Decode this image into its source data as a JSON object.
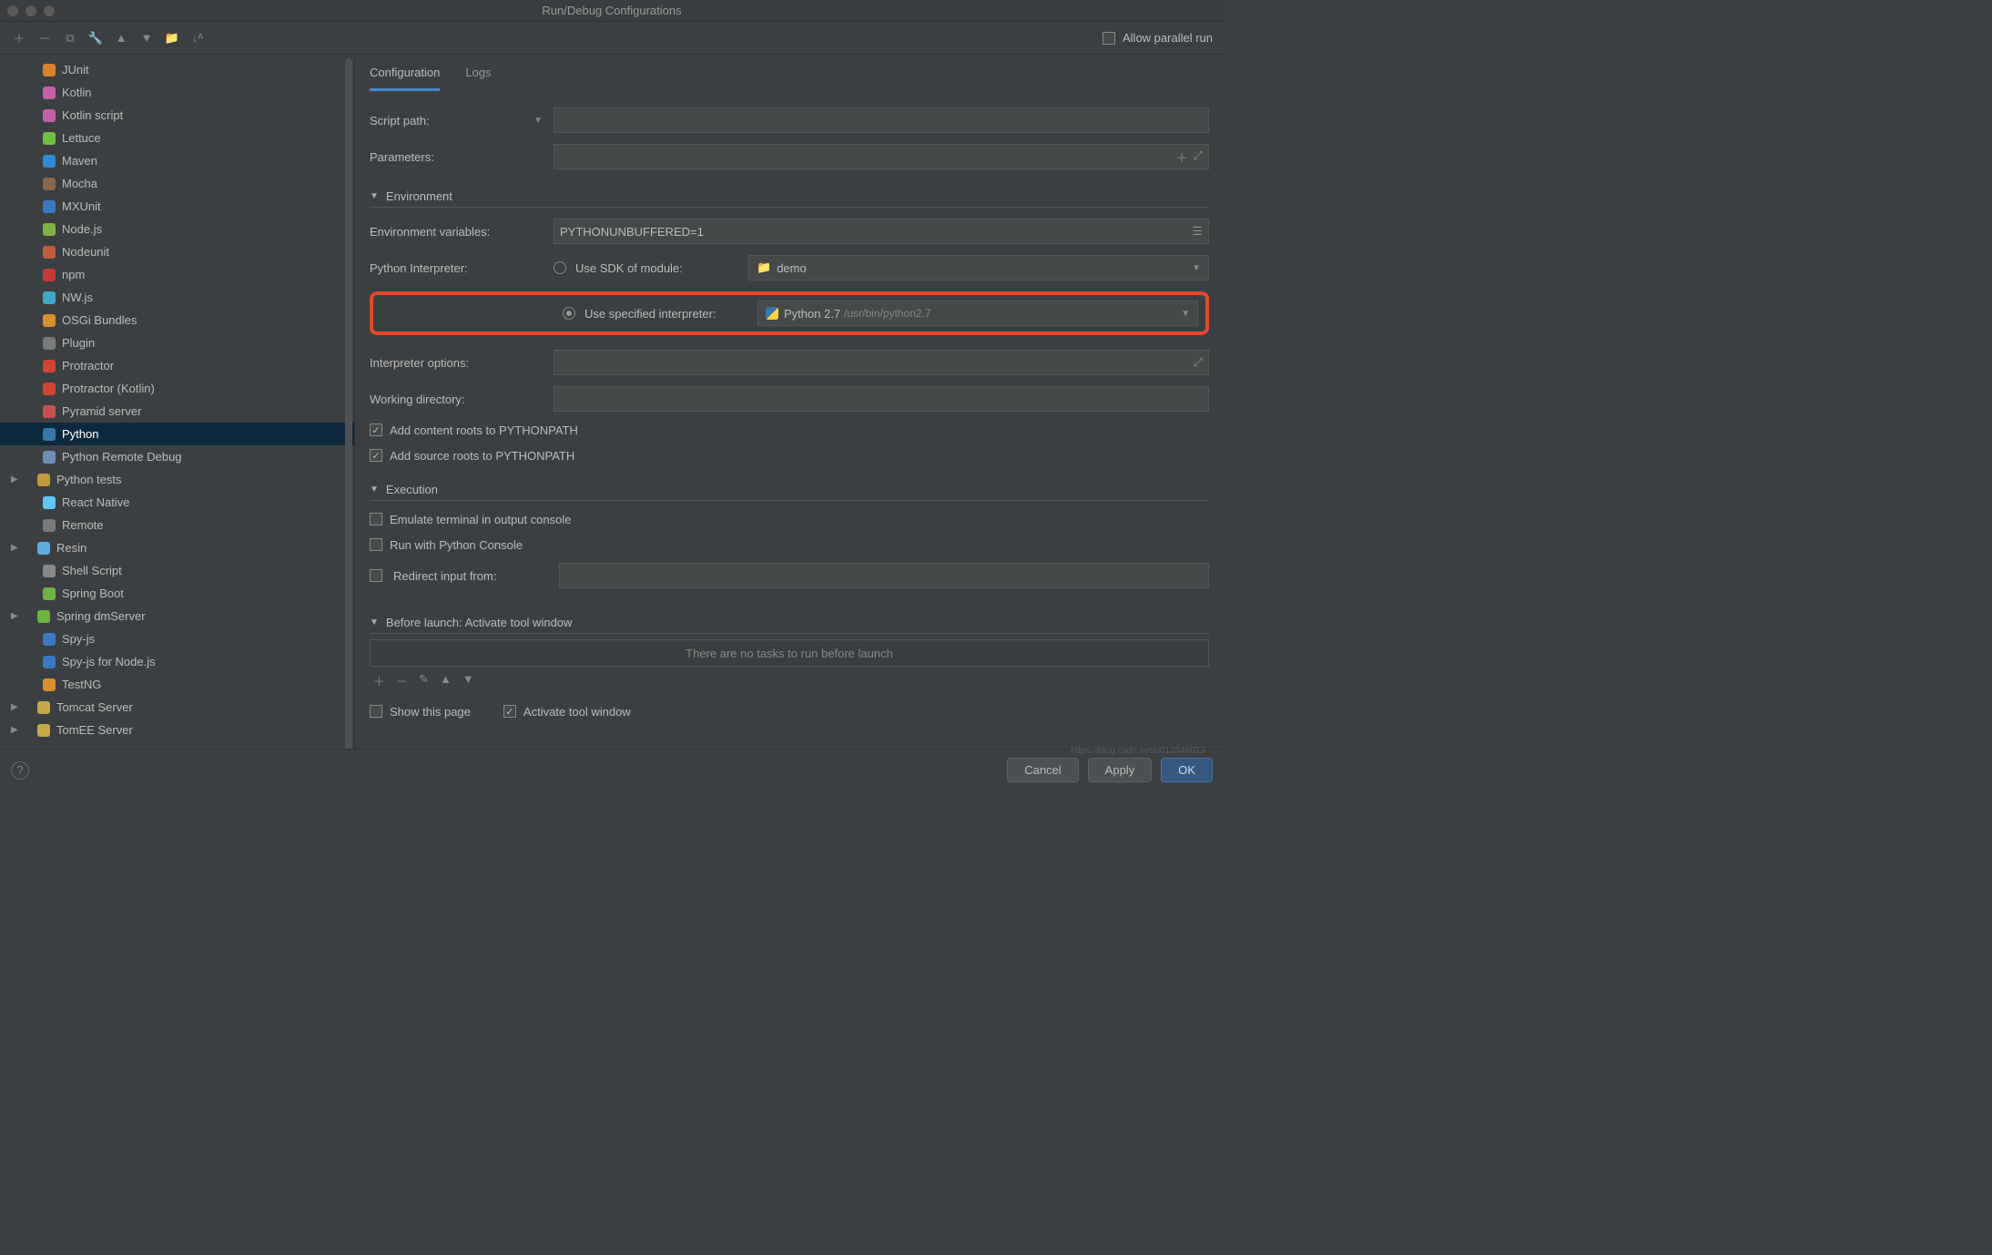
{
  "window": {
    "title": "Run/Debug Configurations"
  },
  "toolbar": {
    "allow_parallel": "Allow parallel run"
  },
  "sidebar": {
    "items": [
      {
        "label": "JUnit",
        "icon_color": "#d9822b",
        "arrow": false
      },
      {
        "label": "Kotlin",
        "icon_color": "#c75eaa",
        "arrow": false
      },
      {
        "label": "Kotlin script",
        "icon_color": "#c75eaa",
        "arrow": false
      },
      {
        "label": "Lettuce",
        "icon_color": "#6fbf3f",
        "arrow": false
      },
      {
        "label": "Maven",
        "icon_color": "#2e8bd8",
        "arrow": false
      },
      {
        "label": "Mocha",
        "icon_color": "#8d6748",
        "arrow": false
      },
      {
        "label": "MXUnit",
        "icon_color": "#3a78c4",
        "arrow": false
      },
      {
        "label": "Node.js",
        "icon_color": "#7cb342",
        "arrow": false
      },
      {
        "label": "Nodeunit",
        "icon_color": "#c15b3a",
        "arrow": false
      },
      {
        "label": "npm",
        "icon_color": "#cb3837",
        "arrow": false
      },
      {
        "label": "NW.js",
        "icon_color": "#3fa9c9",
        "arrow": false
      },
      {
        "label": "OSGi Bundles",
        "icon_color": "#d98f2b",
        "arrow": false
      },
      {
        "label": "Plugin",
        "icon_color": "#7a7a7a",
        "arrow": false
      },
      {
        "label": "Protractor",
        "icon_color": "#d24432",
        "arrow": false
      },
      {
        "label": "Protractor (Kotlin)",
        "icon_color": "#d24432",
        "arrow": false
      },
      {
        "label": "Pyramid server",
        "icon_color": "#c75050",
        "arrow": false
      },
      {
        "label": "Python",
        "icon_color": "#3776ab",
        "arrow": false,
        "selected": true
      },
      {
        "label": "Python Remote Debug",
        "icon_color": "#6a8fb5",
        "arrow": false
      },
      {
        "label": "Python tests",
        "icon_color": "#c19a3a",
        "arrow": true
      },
      {
        "label": "React Native",
        "icon_color": "#5ec8f8",
        "arrow": false
      },
      {
        "label": "Remote",
        "icon_color": "#7a7a7a",
        "arrow": false
      },
      {
        "label": "Resin",
        "icon_color": "#5dade2",
        "arrow": true
      },
      {
        "label": "Shell Script",
        "icon_color": "#888888",
        "arrow": false
      },
      {
        "label": "Spring Boot",
        "icon_color": "#6db33f",
        "arrow": false
      },
      {
        "label": "Spring dmServer",
        "icon_color": "#6db33f",
        "arrow": true
      },
      {
        "label": "Spy-js",
        "icon_color": "#3a78c4",
        "arrow": false
      },
      {
        "label": "Spy-js for Node.js",
        "icon_color": "#3a78c4",
        "arrow": false
      },
      {
        "label": "TestNG",
        "icon_color": "#d98f2b",
        "arrow": false
      },
      {
        "label": "Tomcat Server",
        "icon_color": "#c6a94b",
        "arrow": true
      },
      {
        "label": "TomEE Server",
        "icon_color": "#c6a94b",
        "arrow": true
      }
    ]
  },
  "tabs": {
    "configuration": "Configuration",
    "logs": "Logs"
  },
  "labels": {
    "script_path": "Script path:",
    "parameters": "Parameters:",
    "environment": "Environment",
    "env_vars": "Environment variables:",
    "python_interp": "Python Interpreter:",
    "use_sdk": "Use SDK of module:",
    "use_spec": "Use specified interpreter:",
    "interp_opts": "Interpreter options:",
    "working_dir": "Working directory:",
    "add_content": "Add content roots to PYTHONPATH",
    "add_source": "Add source roots to PYTHONPATH",
    "execution": "Execution",
    "emulate": "Emulate terminal in output console",
    "run_console": "Run with Python Console",
    "redirect": "Redirect input from:",
    "before_launch": "Before launch: Activate tool window",
    "no_tasks": "There are no tasks to run before launch",
    "show_page": "Show this page",
    "activate_tw": "Activate tool window"
  },
  "values": {
    "env_vars": "PYTHONUNBUFFERED=1",
    "sdk_module": "demo",
    "spec_interp_name": "Python 2.7",
    "spec_interp_path": "/usr/bin/python2.7"
  },
  "footer": {
    "cancel": "Cancel",
    "apply": "Apply",
    "ok": "OK"
  },
  "watermark": "https://blog.csdn.net/u012846013"
}
